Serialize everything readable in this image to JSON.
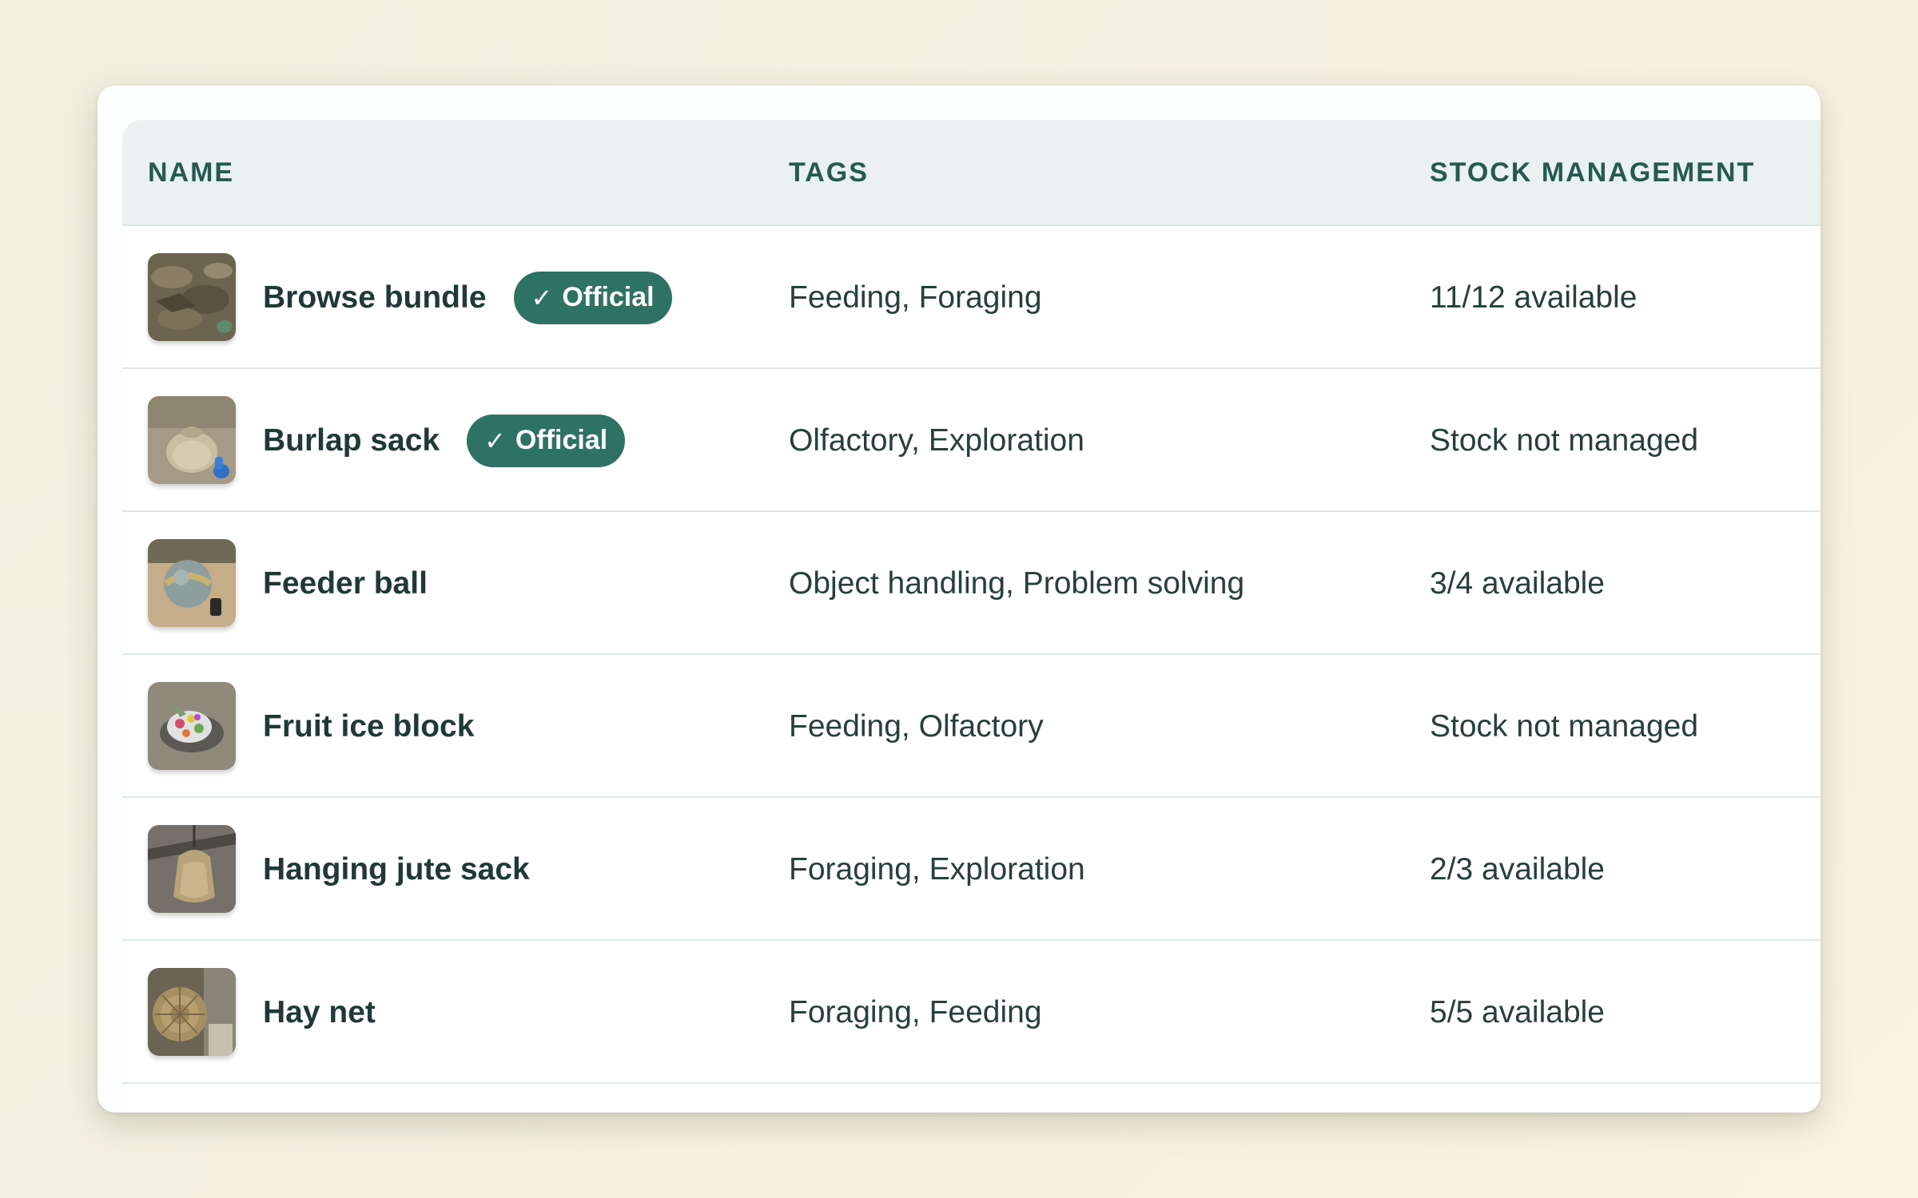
{
  "table": {
    "headers": {
      "name": "NAME",
      "tags": "TAGS",
      "stock": "STOCK MANAGEMENT"
    },
    "badge_label": "Official",
    "badge_icon": "check-icon",
    "rows": [
      {
        "name": "Browse bundle",
        "official": true,
        "tags": "Feeding, Foraging",
        "stock": "11/12 available"
      },
      {
        "name": "Burlap sack",
        "official": true,
        "tags": "Olfactory, Exploration",
        "stock": "Stock not managed"
      },
      {
        "name": "Feeder ball",
        "official": false,
        "tags": "Object handling, Problem solving",
        "stock": "3/4 available"
      },
      {
        "name": "Fruit ice block",
        "official": false,
        "tags": "Feeding, Olfactory",
        "stock": "Stock not managed"
      },
      {
        "name": "Hanging jute sack",
        "official": false,
        "tags": "Foraging, Exploration",
        "stock": "2/3 available"
      },
      {
        "name": "Hay net",
        "official": false,
        "tags": "Foraging, Feeding",
        "stock": "5/5 available"
      }
    ]
  },
  "colors": {
    "badge_bg": "#2e7266",
    "header_bg": "#eaf1f0",
    "header_text": "#245a50"
  }
}
